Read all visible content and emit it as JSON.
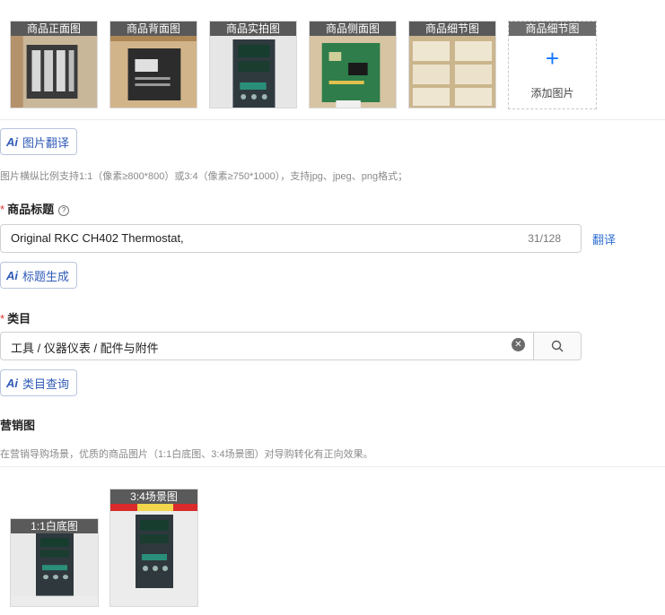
{
  "images": {
    "slots": [
      {
        "label": "商品正面图"
      },
      {
        "label": "商品背面图"
      },
      {
        "label": "商品实拍图"
      },
      {
        "label": "商品侧面图"
      },
      {
        "label": "商品细节图"
      }
    ],
    "add_slot_label": "商品细节图",
    "add_text": "添加图片",
    "ai_translate_label": "图片翻译",
    "hint": "图片横纵比例支持1:1（像素≥800*800）或3:4（像素≥750*1000），支持jpg、jpeg、png格式；"
  },
  "title_field": {
    "required_mark": "*",
    "label": "商品标题",
    "help_icon": "question-circle-icon",
    "value": "Original RKC CH402 Thermostat,",
    "counter": "31/128",
    "translate_link": "翻译",
    "ai_button": "标题生成"
  },
  "category_field": {
    "required_mark": "*",
    "label": "类目",
    "value": "工具 / 仪器仪表 / 配件与附件",
    "ai_button": "类目查询",
    "clear_icon": "clear-circle-icon",
    "search_icon": "search-icon"
  },
  "marketing": {
    "label": "营销图",
    "hint": "在营销导购场景，优质的商品图片（1:1白底图、3:4场景图）对导购转化有正向效果。",
    "images": [
      {
        "label": "1:1白底图"
      },
      {
        "label": "3:4场景图"
      }
    ]
  },
  "ai_badge": "Ai",
  "colors": {
    "accent": "#1677ff",
    "link": "#2f6fd1",
    "required": "#e53935"
  }
}
